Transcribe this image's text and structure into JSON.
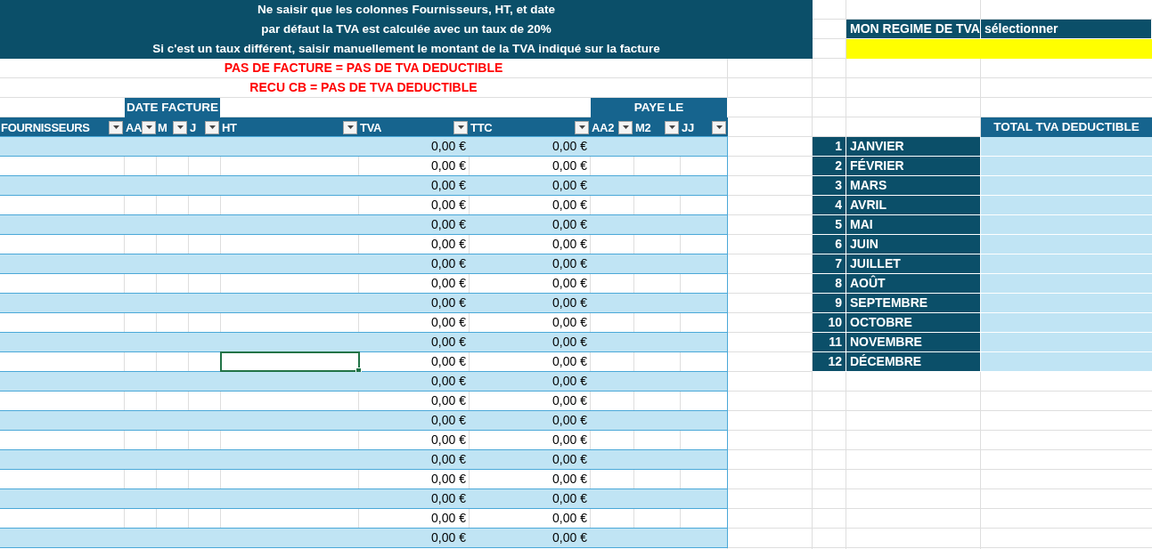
{
  "instructions": [
    "Ne saisir que les colonnes Fournisseurs, HT, et date",
    "par défaut la TVA est calculée avec un taux de 20%",
    "Si c'est un taux différent, saisir manuellement le montant de la TVA indiqué sur la facture"
  ],
  "regime": {
    "label": "MON REGIME DE TVA",
    "hint": "sélectionner"
  },
  "warnings": [
    "PAS DE FACTURE = PAS DE TVA DEDUCTIBLE",
    "RECU CB = PAS DE TVA DEDUCTIBLE"
  ],
  "group_headers": {
    "invoice_date": "DATE FACTURE",
    "paid_on": "PAYE LE"
  },
  "columns": [
    {
      "label": "FOURNISSEURS"
    },
    {
      "label": "AA"
    },
    {
      "label": "M"
    },
    {
      "label": "J"
    },
    {
      "label": "HT"
    },
    {
      "label": "TVA"
    },
    {
      "label": "TTC"
    },
    {
      "label": "AA2"
    },
    {
      "label": "M2"
    },
    {
      "label": "JJ"
    }
  ],
  "rows": [
    {
      "tva": "0,00 €",
      "ttc": "0,00 €",
      "selected": false
    },
    {
      "tva": "0,00 €",
      "ttc": "0,00 €",
      "selected": false
    },
    {
      "tva": "0,00 €",
      "ttc": "0,00 €",
      "selected": false
    },
    {
      "tva": "0,00 €",
      "ttc": "0,00 €",
      "selected": false
    },
    {
      "tva": "0,00 €",
      "ttc": "0,00 €",
      "selected": false
    },
    {
      "tva": "0,00 €",
      "ttc": "0,00 €",
      "selected": false
    },
    {
      "tva": "0,00 €",
      "ttc": "0,00 €",
      "selected": false
    },
    {
      "tva": "0,00 €",
      "ttc": "0,00 €",
      "selected": false
    },
    {
      "tva": "0,00 €",
      "ttc": "0,00 €",
      "selected": false
    },
    {
      "tva": "0,00 €",
      "ttc": "0,00 €",
      "selected": false
    },
    {
      "tva": "0,00 €",
      "ttc": "0,00 €",
      "selected": false
    },
    {
      "tva": "0,00 €",
      "ttc": "0,00 €",
      "selected": true
    },
    {
      "tva": "0,00 €",
      "ttc": "0,00 €",
      "selected": false
    },
    {
      "tva": "0,00 €",
      "ttc": "0,00 €",
      "selected": false
    },
    {
      "tva": "0,00 €",
      "ttc": "0,00 €",
      "selected": false
    },
    {
      "tva": "0,00 €",
      "ttc": "0,00 €",
      "selected": false
    },
    {
      "tva": "0,00 €",
      "ttc": "0,00 €",
      "selected": false
    },
    {
      "tva": "0,00 €",
      "ttc": "0,00 €",
      "selected": false
    },
    {
      "tva": "0,00 €",
      "ttc": "0,00 €",
      "selected": false
    },
    {
      "tva": "0,00 €",
      "ttc": "0,00 €",
      "selected": false
    },
    {
      "tva": "0,00 €",
      "ttc": "0,00 €",
      "selected": false
    }
  ],
  "total_header": "TOTAL TVA DEDUCTIBLE",
  "months": [
    {
      "number": "1",
      "name": "JANVIER"
    },
    {
      "number": "2",
      "name": "FÉVRIER"
    },
    {
      "number": "3",
      "name": "MARS"
    },
    {
      "number": "4",
      "name": "AVRIL"
    },
    {
      "number": "5",
      "name": "MAI"
    },
    {
      "number": "6",
      "name": "JUIN"
    },
    {
      "number": "7",
      "name": "JUILLET"
    },
    {
      "number": "8",
      "name": "AOÛT"
    },
    {
      "number": "9",
      "name": "SEPTEMBRE"
    },
    {
      "number": "10",
      "name": "OCTOBRE"
    },
    {
      "number": "11",
      "name": "NOVEMBRE"
    },
    {
      "number": "12",
      "name": "DÉCEMBRE"
    }
  ]
}
